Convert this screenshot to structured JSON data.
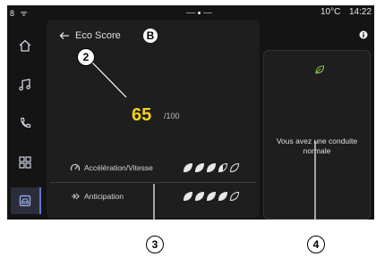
{
  "status_bar": {
    "left_icons": "8 ᯤ",
    "temperature": "10°C",
    "separator": "·",
    "time": "14:22"
  },
  "sidebar": {
    "items": [
      {
        "icon": "home-icon"
      },
      {
        "icon": "music-icon"
      },
      {
        "icon": "phone-icon"
      },
      {
        "icon": "apps-grid-icon"
      },
      {
        "icon": "vehicle-icon",
        "active": true
      }
    ]
  },
  "header": {
    "back_icon": "arrow-left-icon",
    "title": "Eco Score",
    "callout": "B"
  },
  "score": {
    "value": "65",
    "max": "/100"
  },
  "criteria": [
    {
      "label": "Accélération/Vitesse",
      "icon": "speedometer-icon",
      "rating": 3.5,
      "out_of": 5
    },
    {
      "label": "Anticipation",
      "icon": "anticipation-icon",
      "rating": 4,
      "out_of": 5
    }
  ],
  "right_panel": {
    "icon": "leaf-icon",
    "message": "Vous avez une conduite normale"
  },
  "callouts": {
    "two": "2",
    "three": "3",
    "four": "4"
  },
  "colors": {
    "score": "#f3d21a",
    "leaf_active": "#e8e8e8",
    "leaf_green": "#8bc34a",
    "accent": "#5e7bd4"
  }
}
